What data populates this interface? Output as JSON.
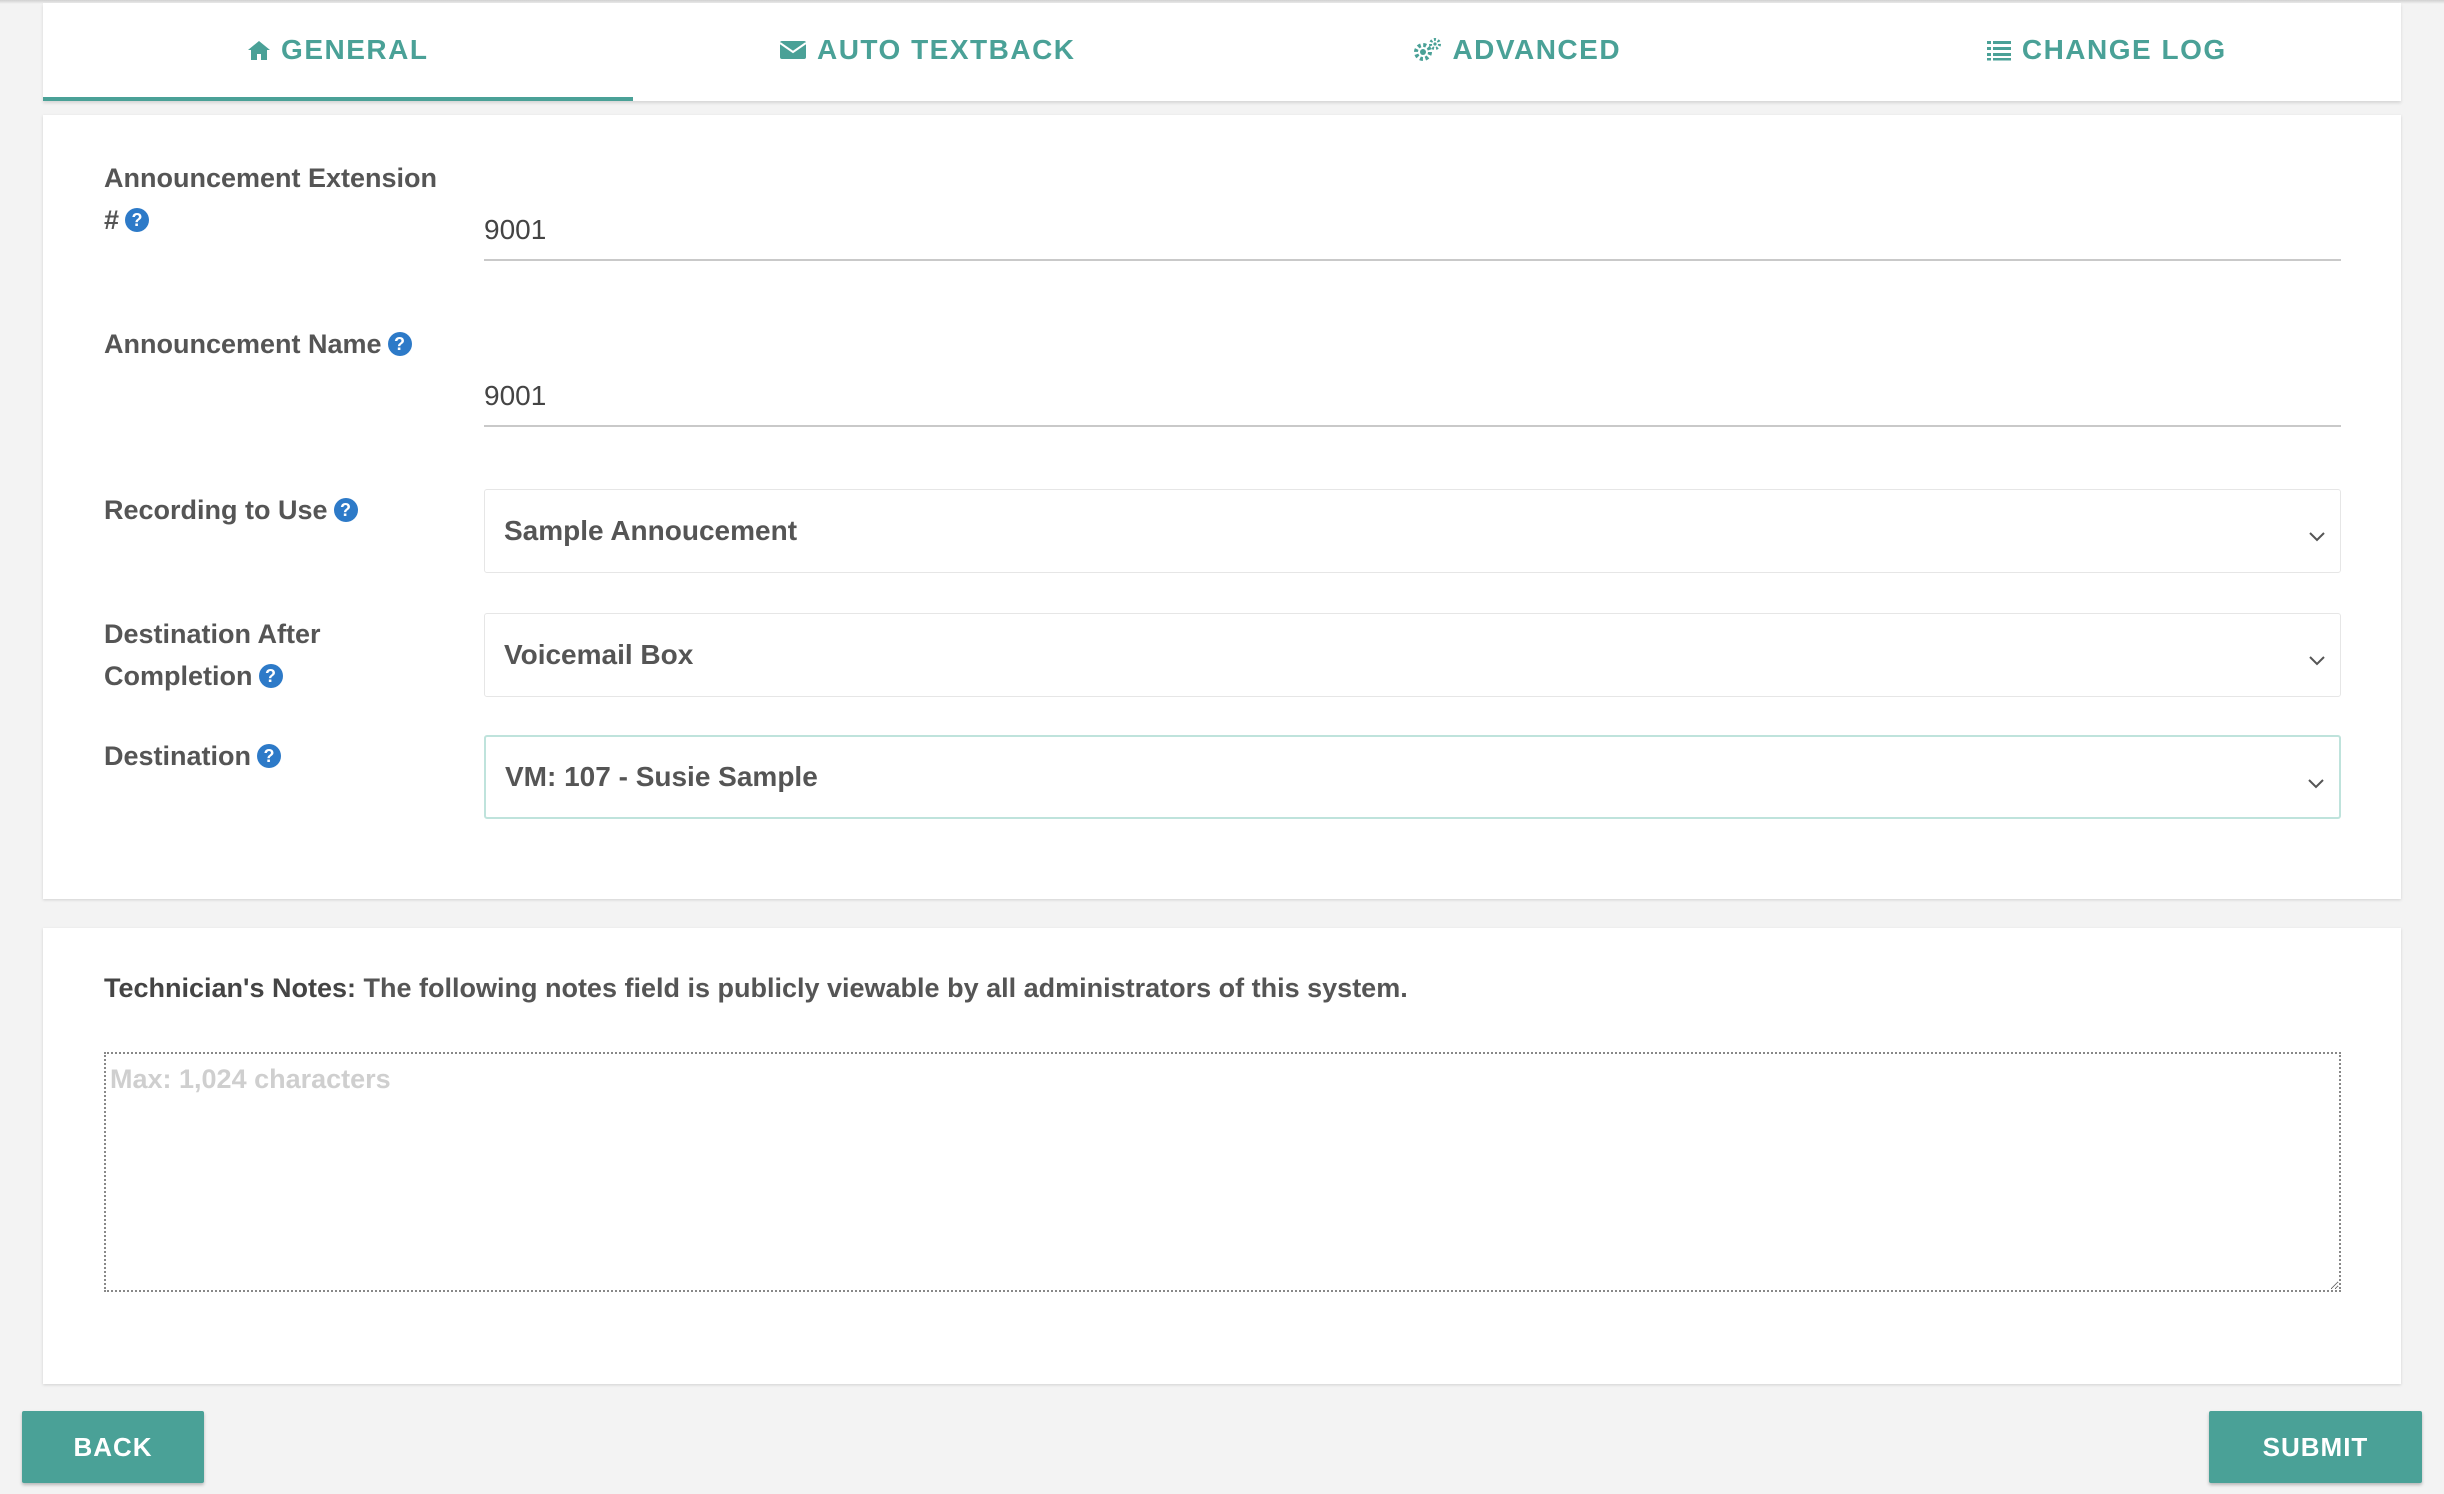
{
  "tabs": [
    {
      "label": "GENERAL",
      "icon": "home-icon",
      "active": true
    },
    {
      "label": "AUTO TEXTBACK",
      "icon": "envelope-icon",
      "active": false
    },
    {
      "label": "ADVANCED",
      "icon": "gears-icon",
      "active": false
    },
    {
      "label": "CHANGE LOG",
      "icon": "list-icon",
      "active": false
    }
  ],
  "form": {
    "extension": {
      "label_line1": "Announcement Extension",
      "label_line2": "#",
      "value": "9001"
    },
    "name": {
      "label": "Announcement Name",
      "value": "9001"
    },
    "recording": {
      "label": "Recording to Use",
      "selected": "Sample Annoucement"
    },
    "after_completion": {
      "label_line1": "Destination After",
      "label_line2": "Completion",
      "selected": "Voicemail Box"
    },
    "destination": {
      "label": "Destination",
      "selected": "VM: 107 - Susie Sample"
    },
    "help_glyph": "?"
  },
  "notes": {
    "title_bold": "Technician's Notes:",
    "title_rest": " The following notes field is publicly viewable by all administrators of this system.",
    "placeholder": "Max: 1,024 characters",
    "value": ""
  },
  "buttons": {
    "back": "BACK",
    "submit": "SUBMIT"
  },
  "colors": {
    "accent": "#4aa197",
    "help_icon": "#2d7ac8",
    "background": "#f3f3f3"
  }
}
